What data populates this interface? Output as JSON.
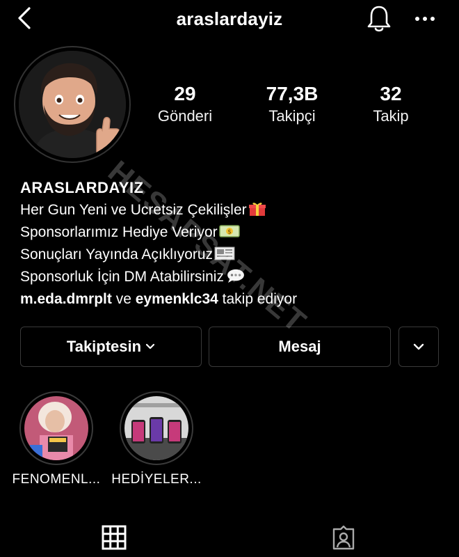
{
  "header": {
    "title": "araslardayiz",
    "back_icon": "chevron-left-icon",
    "bell_icon": "bell-icon",
    "more_icon": "more-horizontal-icon"
  },
  "profile": {
    "avatar_icon": "memoji-thumbs-up-avatar",
    "stats": [
      {
        "value": "29",
        "label": "Gönderi"
      },
      {
        "value": "77,3B",
        "label": "Takipçi"
      },
      {
        "value": "32",
        "label": "Takip"
      }
    ]
  },
  "bio": {
    "name": "ARASLARDAYIZ",
    "lines": [
      "Her Gun Yeni ve Ucretsiz Çekilişler",
      "Sponsorlarımız Hediye Veriyor",
      "Sonuçları Yayında Açıklıyoruz",
      "Sponsorluk İçin DM Atabilirsiniz"
    ],
    "line_emojis": [
      "gift-emoji",
      "money-emoji",
      "newspaper-emoji",
      "speech-bubble-emoji"
    ],
    "followed_by": {
      "user1": "m.eda.dmrplt",
      "connector": "ve",
      "user2": "eymenklc34",
      "suffix": "takip ediyor"
    }
  },
  "actions": {
    "following_label": "Takiptesin",
    "message_label": "Mesaj",
    "dropdown_icon": "chevron-down-icon"
  },
  "highlights": [
    {
      "label": "FENOMENL..."
    },
    {
      "label": "HEDİYELER..."
    }
  ],
  "tabs": {
    "grid_icon": "grid-icon",
    "tagged_icon": "tagged-person-icon"
  },
  "watermark": "HESAPSAT.NET"
}
